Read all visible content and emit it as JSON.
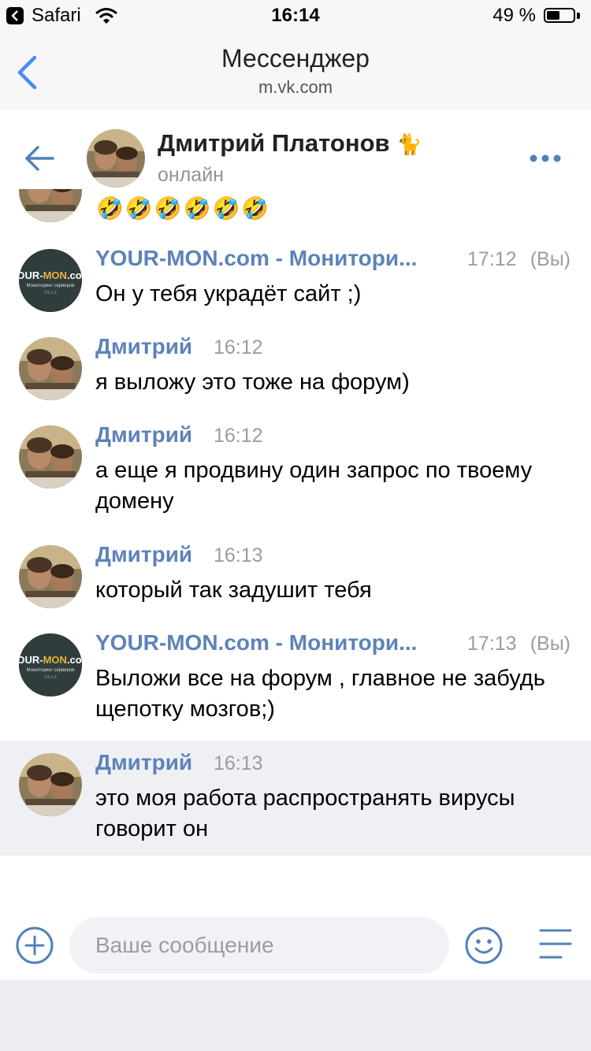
{
  "status_bar": {
    "app": "Safari",
    "time": "16:14",
    "battery": "49 %",
    "battery_level": 0.49
  },
  "safari": {
    "title": "Мессенджер",
    "url": "m.vk.com"
  },
  "chat_header": {
    "name": "Дмитрий Платонов",
    "name_emoji": "🐈",
    "status": "онлайн"
  },
  "partial_message": {
    "emoji": "🤣🤣🤣🤣🤣🤣"
  },
  "messages": [
    {
      "author": "YOUR-MON.com - Монитори...",
      "time": "17:12",
      "you": "(Вы)",
      "text": "Он у тебя украдёт сайт ;)",
      "avatar": "yourmon"
    },
    {
      "author": "Дмитрий",
      "time": "16:12",
      "you": "",
      "text": "я выложу это тоже на форум)",
      "avatar": "dmitry"
    },
    {
      "author": "Дмитрий",
      "time": "16:12",
      "you": "",
      "text": "а еще я продвину один запрос по твоему домену",
      "avatar": "dmitry"
    },
    {
      "author": "Дмитрий",
      "time": "16:13",
      "you": "",
      "text": "который так задушит тебя",
      "avatar": "dmitry"
    },
    {
      "author": "YOUR-MON.com - Монитори...",
      "time": "17:13",
      "you": "(Вы)",
      "text": "Выложи все на форум , главное не забудь щепотку мозгов;)",
      "avatar": "yourmon"
    },
    {
      "author": "Дмитрий",
      "time": "16:13",
      "you": "",
      "text": "это моя работа распространять вирусы говорит он",
      "avatar": "dmitry",
      "highlighted": true
    }
  ],
  "yourmon_logo": {
    "line1a": "YOUR-",
    "line1b": "MON",
    "line1c": ".com",
    "line2": "Мониторинг серверов",
    "line3": "CS 1.6"
  },
  "composer": {
    "placeholder": "Ваше сообщение"
  },
  "colors": {
    "accent": "#5181b8",
    "author": "#5d83b8",
    "muted": "#9a9da1",
    "highlight_bg": "#eef0f3"
  }
}
